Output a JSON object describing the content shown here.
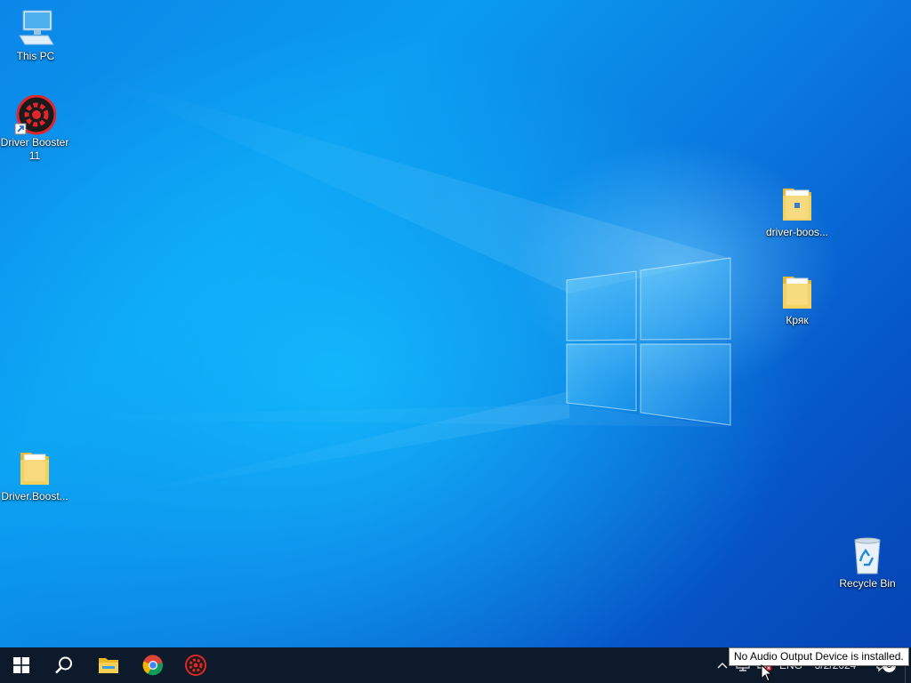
{
  "desktop": {
    "icons": [
      {
        "label": "This PC",
        "icon": "this-pc-icon"
      },
      {
        "label": "Driver Booster 11",
        "icon": "driver-booster-shortcut-icon"
      },
      {
        "label": "driver-boos...",
        "icon": "folder-icon"
      },
      {
        "label": "Кряк",
        "icon": "folder-icon"
      },
      {
        "label": "Driver.Boost...",
        "icon": "folder-icon"
      },
      {
        "label": "Recycle Bin",
        "icon": "recycle-bin-icon"
      }
    ]
  },
  "taskbar": {
    "start": "windows-logo-icon",
    "search": "search-icon",
    "pinned": [
      "file-explorer-icon",
      "chrome-icon",
      "driver-booster-icon"
    ],
    "tray": {
      "language": "ENG",
      "date": "3/2/2024",
      "notification_count": "3"
    }
  },
  "tooltip": {
    "text": "No Audio Output Device is installed."
  },
  "colors": {
    "taskbar": "#0c1a2b",
    "wallpaper_accent": "#0a9cf0"
  }
}
